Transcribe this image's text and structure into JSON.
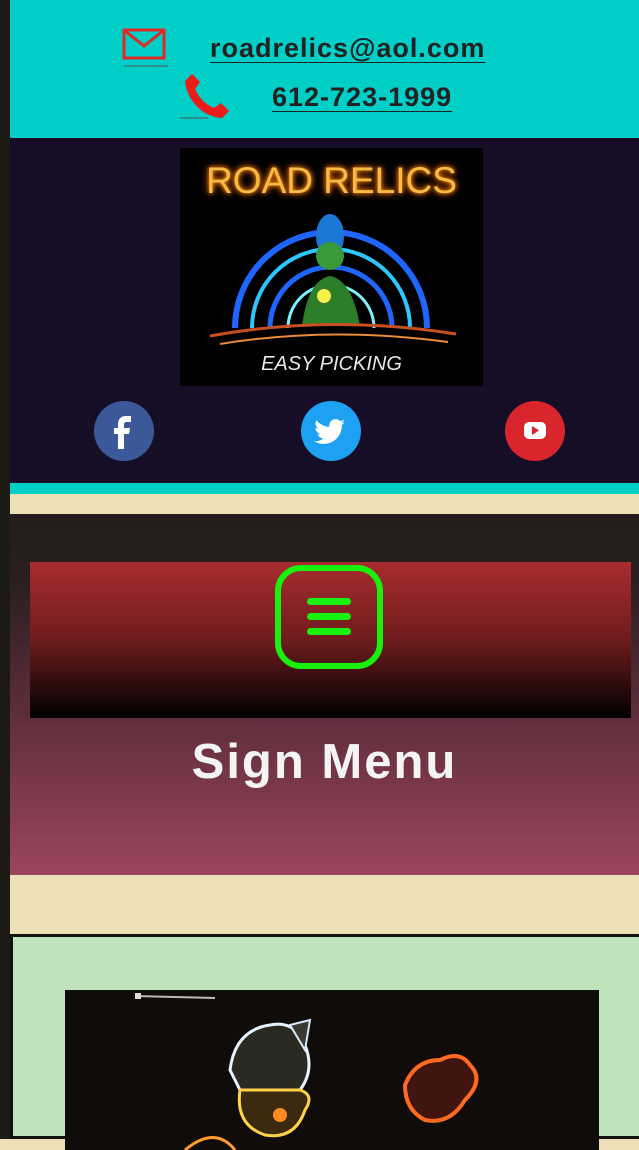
{
  "contact": {
    "email": "roadrelics@aol.com",
    "phone": "612-723-1999"
  },
  "logo": {
    "title": "ROAD RELICS",
    "tagline": "EASY PICKING"
  },
  "social": {
    "facebook": "facebook-icon",
    "twitter": "twitter-icon",
    "youtube": "youtube-icon"
  },
  "menu": {
    "label": "Sign Menu"
  },
  "colors": {
    "teal": "#00cfc7",
    "navy": "#160e26",
    "hamburger_green": "#18f00e",
    "cream": "#ede0b7",
    "mint": "#bfe3bd"
  }
}
